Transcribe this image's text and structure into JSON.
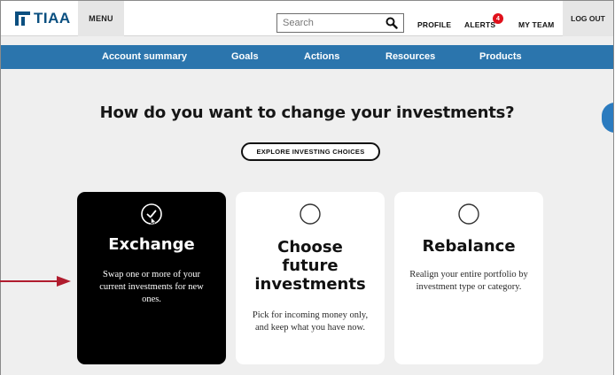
{
  "brand": {
    "logo_text": "TIAA",
    "logo_color": "#0a4f80"
  },
  "header": {
    "menu_label": "MENU",
    "search": {
      "placeholder": "Search",
      "value": ""
    },
    "links": {
      "profile": "PROFILE",
      "alerts": "ALERTS",
      "my_team": "MY TEAM",
      "logout": "LOG OUT"
    },
    "alerts_count": "4"
  },
  "nav": {
    "items": [
      "Account summary",
      "Goals",
      "Actions",
      "Resources",
      "Products"
    ],
    "background": "#2b75ad"
  },
  "main": {
    "headline": "How do you want to change your investments?",
    "explore_label": "EXPLORE INVESTING CHOICES",
    "cards": [
      {
        "title": "Exchange",
        "description": "Swap one or more of your current investments for new ones.",
        "selected": true,
        "icon": "check-circle-icon"
      },
      {
        "title": "Choose future investments",
        "description": "Pick for incoming money only, and keep what you have now.",
        "selected": false,
        "icon": "radio-circle-icon"
      },
      {
        "title": "Rebalance",
        "description": "Realign your entire portfolio by investment type or category.",
        "selected": false,
        "icon": "radio-circle-icon"
      }
    ]
  },
  "colors": {
    "annotation_arrow": "#b01c2e",
    "alert_badge": "#e0101b",
    "page_background": "#efefef"
  }
}
